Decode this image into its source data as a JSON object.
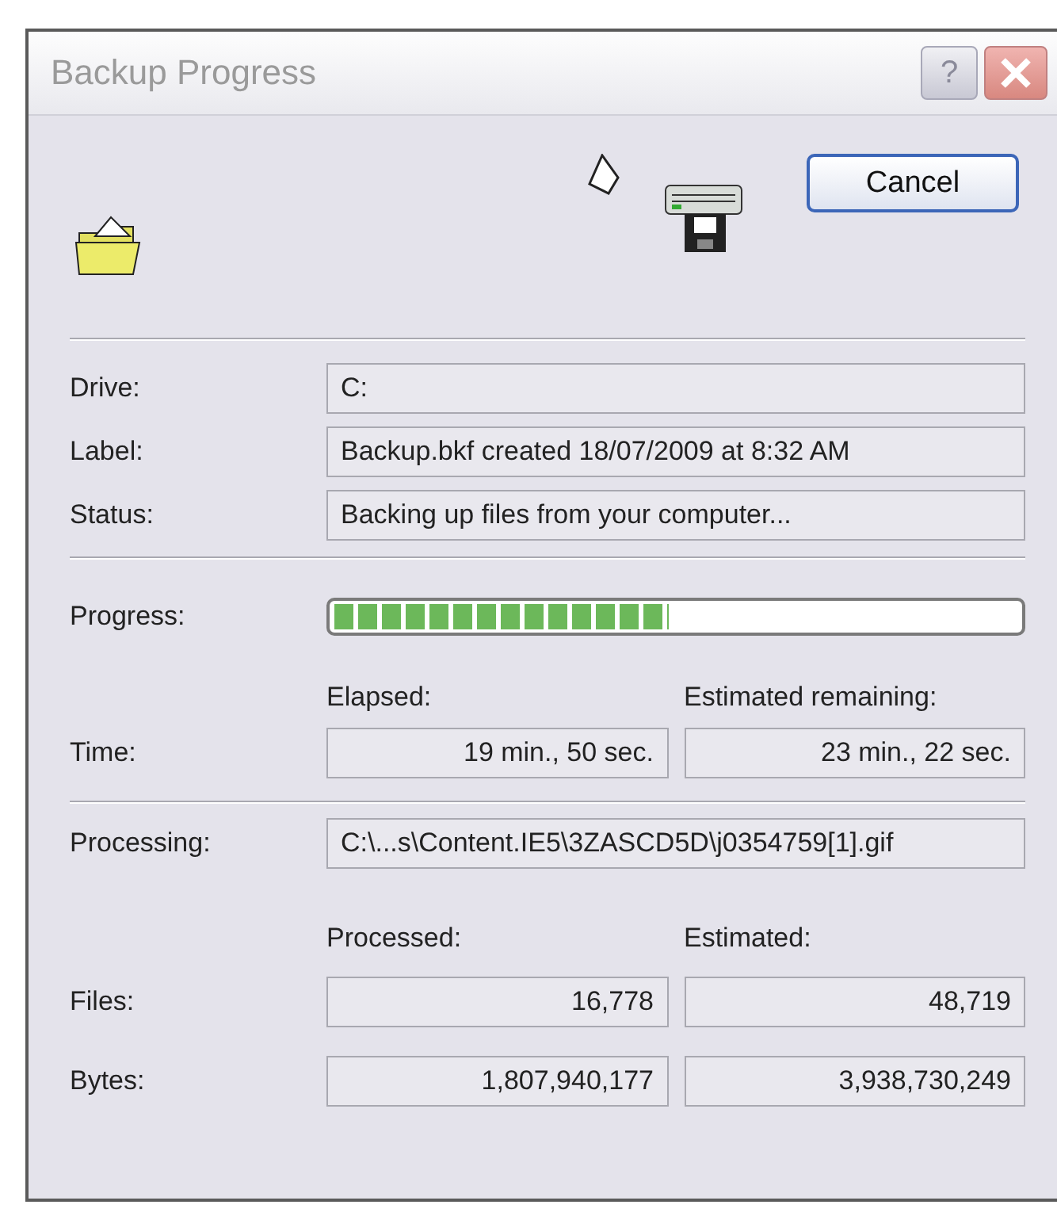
{
  "window": {
    "title": "Backup Progress",
    "help_button": "?"
  },
  "cancel_button": "Cancel",
  "info": [
    {
      "label": "Drive:",
      "value": "C:"
    },
    {
      "label": "Label:",
      "value": "Backup.bkf created 18/07/2009 at 8:32 AM"
    },
    {
      "label": "Status:",
      "value": "Backing up files from your computer..."
    }
  ],
  "progress": {
    "label": "Progress:",
    "level": 0.49
  },
  "time": {
    "label": "Time:",
    "columns": [
      "Elapsed:",
      "Estimated remaining:"
    ],
    "values": [
      "19 min., 50 sec.",
      "23 min., 22 sec."
    ]
  },
  "processing": {
    "label": "Processing:",
    "value": "C:\\...s\\Content.IE5\\3ZASCD5D\\j0354759[1].gif"
  },
  "counts": {
    "columns": [
      "Processed:",
      "Estimated:"
    ],
    "rows": [
      {
        "label": "Files:",
        "values": [
          "16,778",
          "48,719"
        ]
      },
      {
        "label": "Bytes:",
        "values": [
          "1,807,940,177",
          "3,938,730,249"
        ]
      }
    ]
  }
}
